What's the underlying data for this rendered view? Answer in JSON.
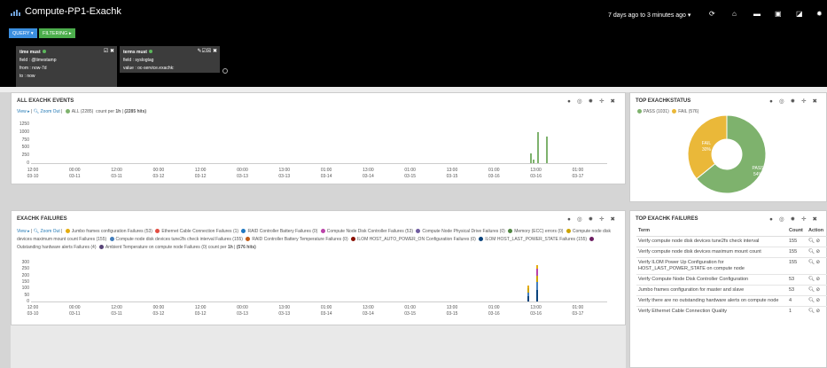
{
  "app": {
    "title": "Compute-PP1-Exachk",
    "timefilter": "7 days ago to 3 minutes ago ▾"
  },
  "colors": {
    "blue": "#1f77b4",
    "green": "#5cb85c",
    "pass": "#7eb26d",
    "fail": "#eab839"
  },
  "nav_icons": [
    "refresh-icon",
    "home-icon",
    "folder-open-icon",
    "save-icon",
    "share-icon",
    "gear-icon"
  ],
  "query": {
    "query_pill": "QUERY ▾",
    "filter_pill": "FILTERING ▸"
  },
  "filters": [
    {
      "head": "time must",
      "lines": [
        "field : @timestamp",
        "from : now-7d",
        "to : now"
      ]
    },
    {
      "head": "terms must",
      "lines": [
        "field : syslogtag",
        "value : oc-service.exachk:"
      ]
    }
  ],
  "panels": {
    "events": {
      "title": "ALL EXACHK EVENTS",
      "view": "View ▸",
      "zoom": "Zoom Out",
      "legend_all": "ALL (2285)",
      "count_prefix": "count per ",
      "count_interval": "1h",
      "count_sep": " | ",
      "count_total": "(2285 hits)"
    },
    "status": {
      "title": "TOP EXACHKSTATUS",
      "pass_legend": "PASS (1031)",
      "fail_legend": "FAIL (576)",
      "pass_label": "PASS",
      "pass_pct": "54%",
      "fail_label": "FAIL",
      "fail_pct": "30%"
    },
    "failures": {
      "title": "EXACHK FAILURES",
      "view": "View ▸",
      "zoom": "Zoom Out",
      "legend": [
        {
          "label": "Jumbo frames configuration Failures (53)",
          "color": "#e5ac0e"
        },
        {
          "label": "Ethernet Cable Connection Failures (1)",
          "color": "#e24d42"
        },
        {
          "label": "RAID Controller Battery Failures (0)",
          "color": "#1f78c1"
        },
        {
          "label": "Compute Node Disk Controller Failures (53)",
          "color": "#ba43a9"
        },
        {
          "label": "Compute Node Physical Drive Failures (0)",
          "color": "#705da0"
        },
        {
          "label": "Memory (ECC) errors (0)",
          "color": "#508642"
        },
        {
          "label": "Compute node disk devices maximum mount count Failures (155)",
          "color": "#cca300"
        },
        {
          "label": "Compute node disk devices tune2fs check interval Failures (155)",
          "color": "#447ebc"
        },
        {
          "label": "RAID Controller Battery Temperature Failures (0)",
          "color": "#c15c17"
        },
        {
          "label": "ILOM HOST_AUTO_POWER_ON Configuration Failures (0)",
          "color": "#890f02"
        },
        {
          "label": "ILOM HOST_LAST_POWER_STATE Failures (155)",
          "color": "#0a437c"
        },
        {
          "label": "Outstanding hardware alerts Failures (4)",
          "color": "#6d1f62"
        },
        {
          "label": "Ambient Temperature on compute node Failures (0)",
          "color": "#584477"
        }
      ],
      "count_prefix": "count per ",
      "count_interval": "1h",
      "count_sep": " | ",
      "count_total": "(576 hits)"
    },
    "top_failures": {
      "title": "TOP EXACHK FAILURES",
      "headers": [
        "Term",
        "Count",
        "Action"
      ],
      "rows": [
        {
          "term": "Verify compute node disk devices tune2fs check interval",
          "count": "155"
        },
        {
          "term": "Verify compute node disk devices maximum mount count",
          "count": "155"
        },
        {
          "term": "Verify ILOM Power Up Configuration for HOST_LAST_POWER_STATE on compute node",
          "count": "155"
        },
        {
          "term": "Verify Compute Node Disk Controller Configuration",
          "count": "53"
        },
        {
          "term": "Jumbo frames configuration for master and slave",
          "count": "53"
        },
        {
          "term": "Verify there are no outstanding hardware alerts on compute node",
          "count": "4"
        },
        {
          "term": "Verify Ethernet Cable Connection Quality",
          "count": "1"
        }
      ]
    }
  },
  "chart_data": [
    {
      "type": "bar",
      "title": "ALL EXACHK EVENTS",
      "yticks": [
        "1250",
        "1000",
        "750",
        "500",
        "250",
        "0"
      ],
      "ylim": [
        0,
        1250
      ],
      "xticks": [
        [
          "12:00",
          "03-10"
        ],
        [
          "00:00",
          "03-11"
        ],
        [
          "12:00",
          "03-11"
        ],
        [
          "00:00",
          "03-12"
        ],
        [
          "12:00",
          "03-12"
        ],
        [
          "00:00",
          "03-13"
        ],
        [
          "13:00",
          "03-13"
        ],
        [
          "01:00",
          "03-14"
        ],
        [
          "13:00",
          "03-14"
        ],
        [
          "01:00",
          "03-15"
        ],
        [
          "13:00",
          "03-15"
        ],
        [
          "01:00",
          "03-16"
        ],
        [
          "13:00",
          "03-16"
        ],
        [
          "01:00",
          "03-17"
        ]
      ],
      "series": [
        {
          "name": "ALL",
          "x": [
            11.85,
            11.93,
            12.04,
            12.25
          ],
          "values": [
            300,
            100,
            1000,
            850
          ]
        }
      ]
    },
    {
      "type": "bar",
      "title": "EXACHK FAILURES",
      "yticks": [
        "300",
        "250",
        "200",
        "150",
        "100",
        "50",
        "0"
      ],
      "ylim": [
        0,
        300
      ],
      "xticks": [
        [
          "12:00",
          "03-10"
        ],
        [
          "00:00",
          "03-11"
        ],
        [
          "12:00",
          "03-11"
        ],
        [
          "00:00",
          "03-12"
        ],
        [
          "12:00",
          "03-12"
        ],
        [
          "00:00",
          "03-13"
        ],
        [
          "13:00",
          "03-13"
        ],
        [
          "01:00",
          "03-14"
        ],
        [
          "13:00",
          "03-14"
        ],
        [
          "01:00",
          "03-15"
        ],
        [
          "13:00",
          "03-15"
        ],
        [
          "01:00",
          "03-16"
        ],
        [
          "13:00",
          "03-16"
        ],
        [
          "01:00",
          "03-17"
        ]
      ],
      "stacks": [
        {
          "x": 11.8,
          "segments": [
            {
              "color": "#0a437c",
              "value": 40
            },
            {
              "color": "#447ebc",
              "value": 30
            },
            {
              "color": "#cca300",
              "value": 35
            },
            {
              "color": "#e5ac0e",
              "value": 20
            }
          ]
        },
        {
          "x": 12.0,
          "segments": [
            {
              "color": "#0a437c",
              "value": 90
            },
            {
              "color": "#447ebc",
              "value": 60
            },
            {
              "color": "#cca300",
              "value": 50
            },
            {
              "color": "#ba43a9",
              "value": 50
            },
            {
              "color": "#e5ac0e",
              "value": 30
            }
          ]
        }
      ]
    },
    {
      "type": "pie",
      "title": "TOP EXACHKSTATUS",
      "slices": [
        {
          "name": "PASS",
          "value": 1031,
          "color": "#7eb26d"
        },
        {
          "name": "FAIL",
          "value": 576,
          "color": "#eab839"
        }
      ]
    }
  ]
}
